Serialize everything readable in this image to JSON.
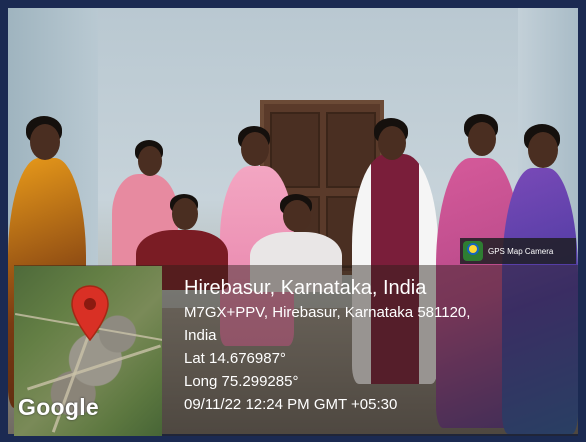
{
  "badge": {
    "label": "GPS Map Camera"
  },
  "map": {
    "brand": "Google"
  },
  "location": {
    "title": "Hirebasur, Karnataka, India",
    "address_line1": "M7GX+PPV, Hirebasur, Karnataka 581120,",
    "address_line2": "India",
    "lat": "Lat 14.676987°",
    "long": "Long 75.299285°",
    "datetime": "09/11/22 12:24 PM GMT +05:30"
  }
}
